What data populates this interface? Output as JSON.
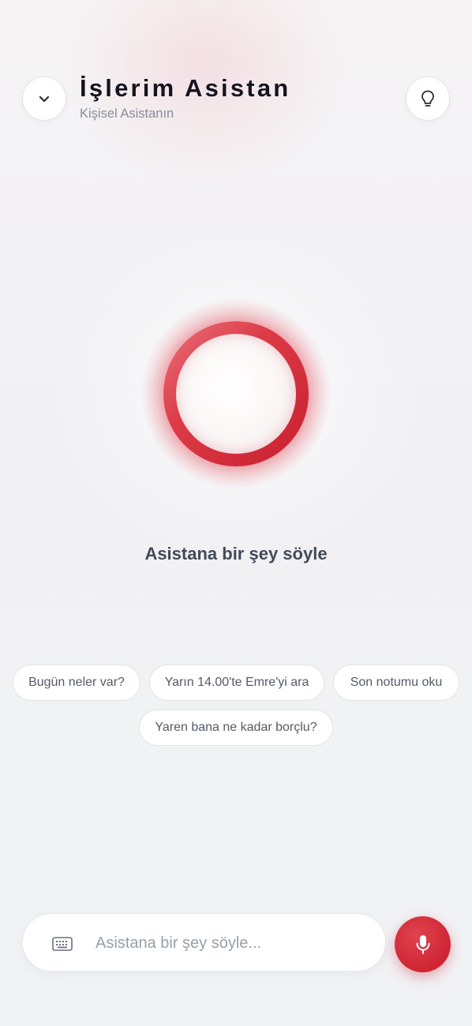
{
  "header": {
    "title": "İşlerim Asistan",
    "subtitle": "Kişisel Asistanın",
    "collapse_icon": "chevron-down-icon",
    "tips_icon": "lightbulb-icon"
  },
  "orb": {
    "state_icon": "voice-orb",
    "accent_color": "#dc3a47"
  },
  "prompt": "Asistana bir şey söyle",
  "suggestions": [
    "Bugün neler var?",
    "Yarın 14.00'te Emre'yi ara",
    "Son notumu oku",
    "Yaren bana ne kadar borçlu?"
  ],
  "input": {
    "placeholder": "Asistana bir şey söyle...",
    "value": "",
    "keyboard_icon": "keyboard-icon",
    "mic_icon": "microphone-icon",
    "mic_color": "#cf2533"
  }
}
